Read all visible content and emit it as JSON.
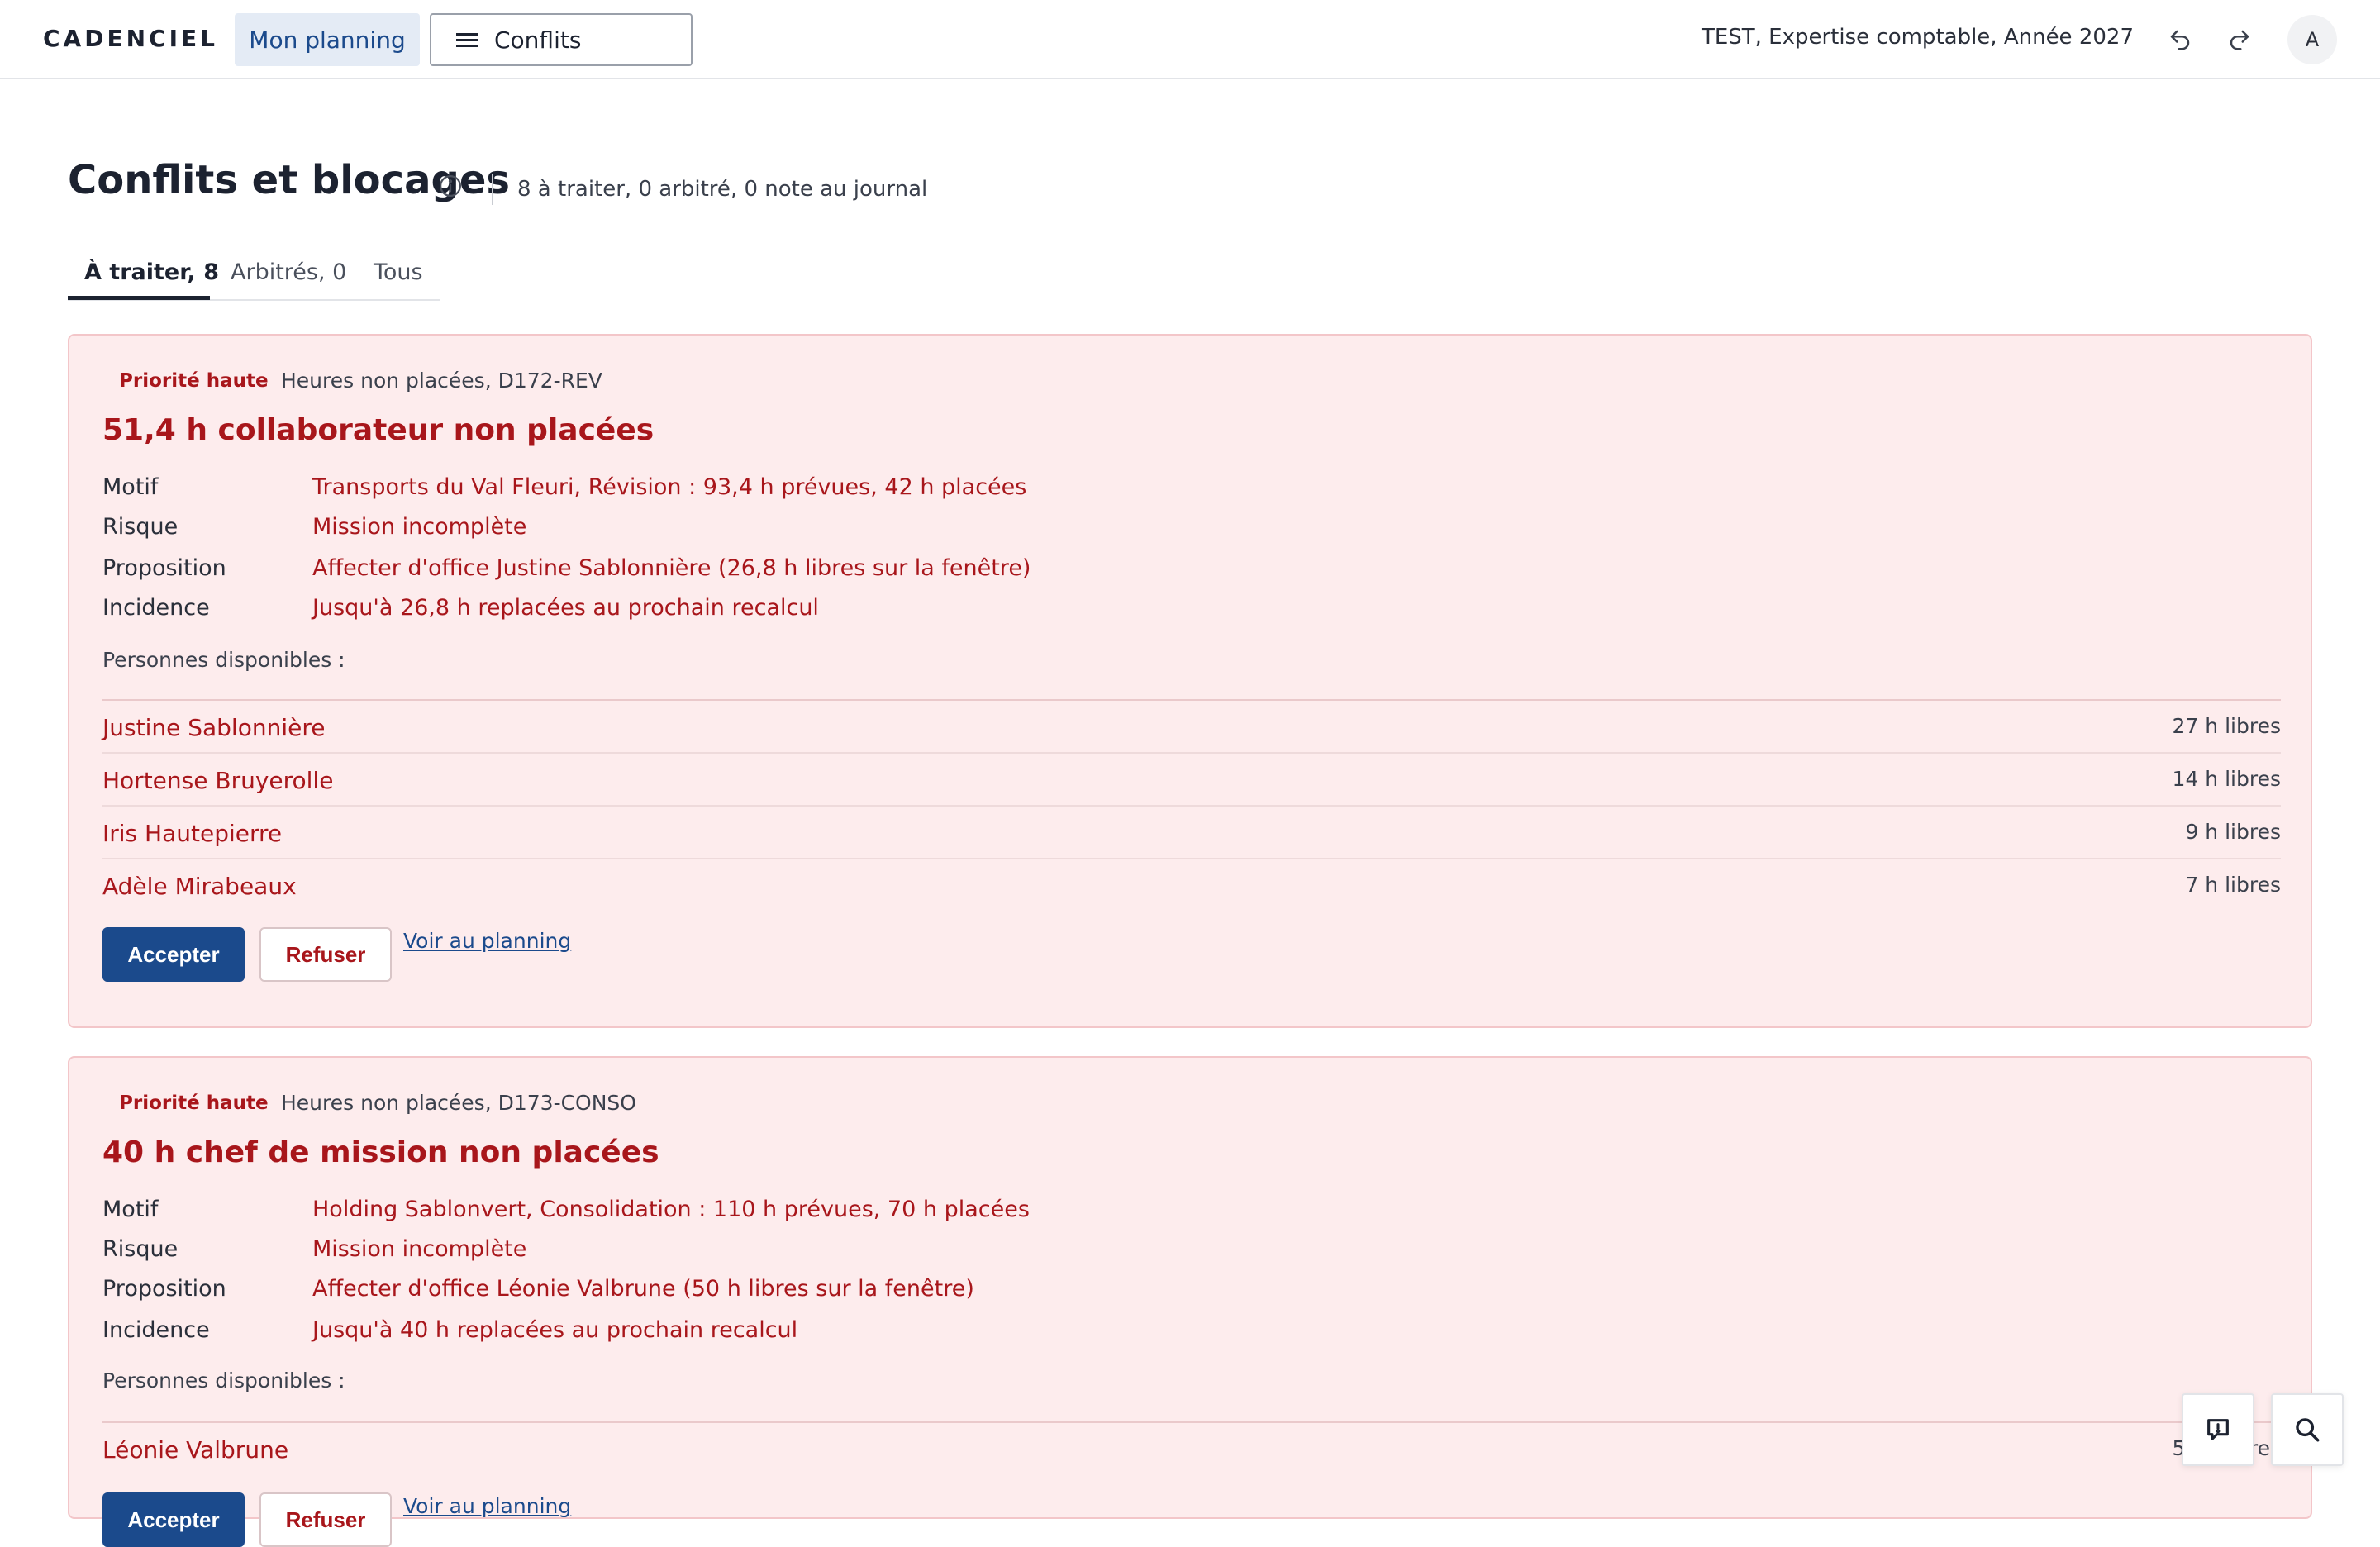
{
  "header": {
    "brand": "CADENCIEL",
    "nav_planning": "Mon planning",
    "nav_conflits": "Conflits",
    "context": "TEST, Expertise comptable, Année 2027",
    "avatar_initial": "A"
  },
  "page": {
    "title": "Conflits et blocages",
    "summary": "8 à traiter, 0 arbitré, 0 note au journal",
    "tabs": [
      "À traiter, 8",
      "Arbitrés, 0",
      "Tous"
    ]
  },
  "labels": {
    "motif": "Motif",
    "risque": "Risque",
    "proposition": "Proposition",
    "incidence": "Incidence",
    "available": "Personnes disponibles :",
    "accept": "Accepter",
    "refuse": "Refuser",
    "see_planning": "Voir au planning"
  },
  "conflicts": [
    {
      "priority": "Priorité haute",
      "type": "Heures non placées, D172-REV",
      "title": "51,4 h collaborateur non placées",
      "motif": "Transports du Val Fleuri, Révision : 93,4 h prévues, 42 h placées",
      "risque": "Mission incomplète",
      "proposition": "Affecter d'office Justine Sablonnière (26,8 h libres sur la fenêtre)",
      "incidence": "Jusqu'à 26,8 h replacées au prochain recalcul",
      "people": [
        {
          "name": "Justine Sablonnière",
          "hours": "27 h libres"
        },
        {
          "name": "Hortense Bruyerolle",
          "hours": "14 h libres"
        },
        {
          "name": "Iris Hautepierre",
          "hours": "9 h libres"
        },
        {
          "name": "Adèle Mirabeaux",
          "hours": "7 h libres"
        }
      ]
    },
    {
      "priority": "Priorité haute",
      "type": "Heures non placées, D173-CONSO",
      "title": "40 h chef de mission non placées",
      "motif": "Holding Sablonvert, Consolidation : 110 h prévues, 70 h placées",
      "risque": "Mission incomplète",
      "proposition": "Affecter d'office Léonie Valbrune (50 h libres sur la fenêtre)",
      "incidence": "Jusqu'à 40 h replacées au prochain recalcul",
      "people": [
        {
          "name": "Léonie Valbrune",
          "hours": "50 h libres"
        }
      ]
    }
  ]
}
